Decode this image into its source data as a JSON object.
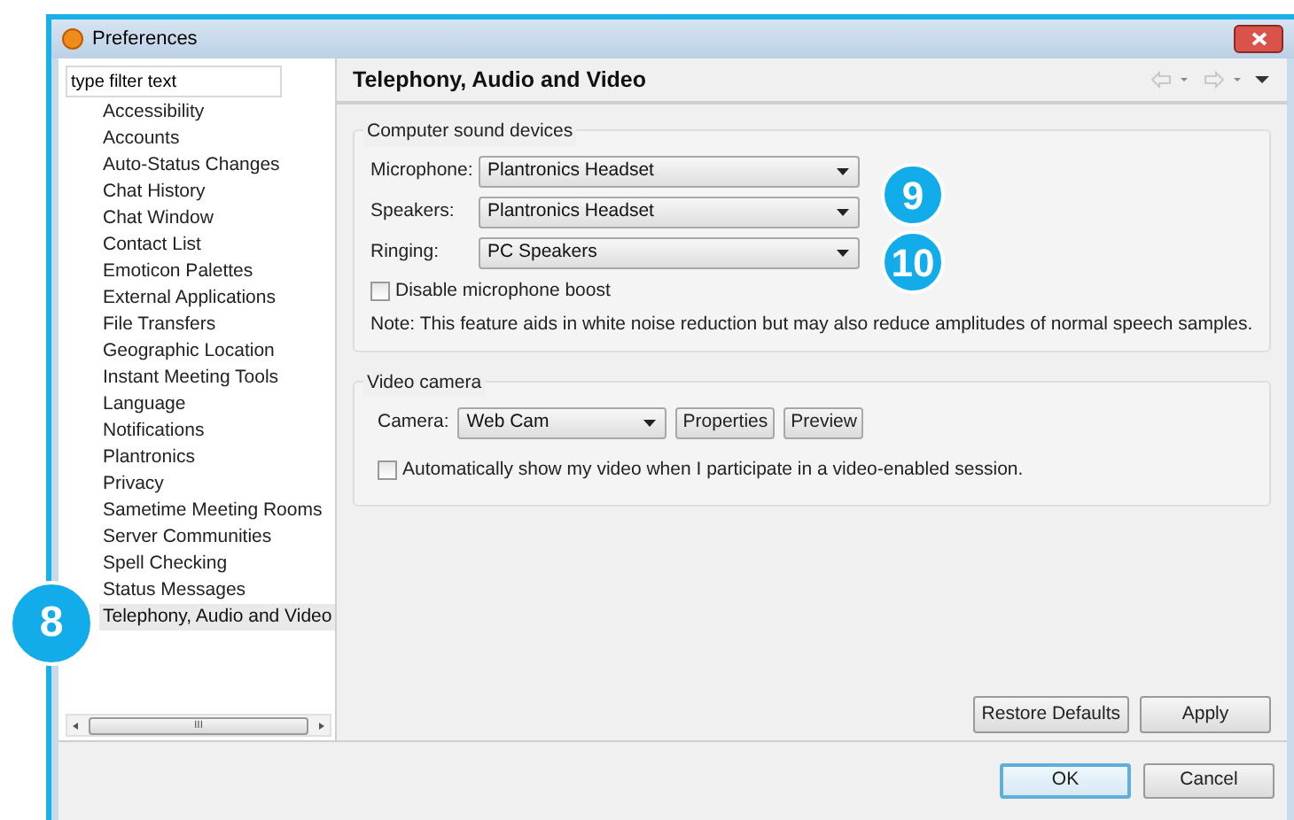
{
  "window": {
    "title": "Preferences"
  },
  "filter": {
    "value": "type filter text"
  },
  "sidebar": {
    "items": [
      {
        "label": "Accessibility",
        "selected": false
      },
      {
        "label": "Accounts",
        "selected": false
      },
      {
        "label": "Auto-Status Changes",
        "selected": false
      },
      {
        "label": "Chat History",
        "selected": false
      },
      {
        "label": "Chat Window",
        "selected": false
      },
      {
        "label": "Contact List",
        "selected": false
      },
      {
        "label": "Emoticon Palettes",
        "selected": false
      },
      {
        "label": "External Applications",
        "selected": false
      },
      {
        "label": "File Transfers",
        "selected": false
      },
      {
        "label": "Geographic Location",
        "selected": false
      },
      {
        "label": "Instant Meeting Tools",
        "selected": false
      },
      {
        "label": "Language",
        "selected": false
      },
      {
        "label": "Notifications",
        "selected": false
      },
      {
        "label": "Plantronics",
        "selected": false
      },
      {
        "label": "Privacy",
        "selected": false
      },
      {
        "label": "Sametime Meeting Rooms",
        "selected": false
      },
      {
        "label": "Server Communities",
        "selected": false
      },
      {
        "label": "Spell Checking",
        "selected": false
      },
      {
        "label": "Status Messages",
        "selected": false
      },
      {
        "label": "Telephony, Audio and Video",
        "selected": true
      }
    ],
    "scrollbar_grip": "III"
  },
  "page": {
    "title": "Telephony, Audio and Video"
  },
  "sound_devices": {
    "title": "Computer sound devices",
    "fields": [
      {
        "label": "Microphone:",
        "value": "Plantronics Headset"
      },
      {
        "label": "Speakers:",
        "value": "Plantronics Headset"
      },
      {
        "label": "Ringing:",
        "value": "PC Speakers"
      }
    ],
    "checkbox": {
      "label": "Disable microphone boost",
      "checked": false
    },
    "note": "Note: This feature aids in white noise reduction but may also reduce amplitudes of normal speech samples."
  },
  "video_camera": {
    "title": "Video camera",
    "camera": {
      "label": "Camera:",
      "value": "Web Cam"
    },
    "buttons": [
      "Properties",
      "Preview"
    ],
    "checkbox": {
      "label": "Automatically show my video when I participate in a video-enabled session.",
      "checked": false
    }
  },
  "page_buttons": [
    "Restore Defaults",
    "Apply"
  ],
  "dialog_buttons": [
    {
      "label": "OK",
      "default": true
    },
    {
      "label": "Cancel",
      "default": false
    }
  ],
  "callouts": [
    "8",
    "9",
    "10"
  ]
}
